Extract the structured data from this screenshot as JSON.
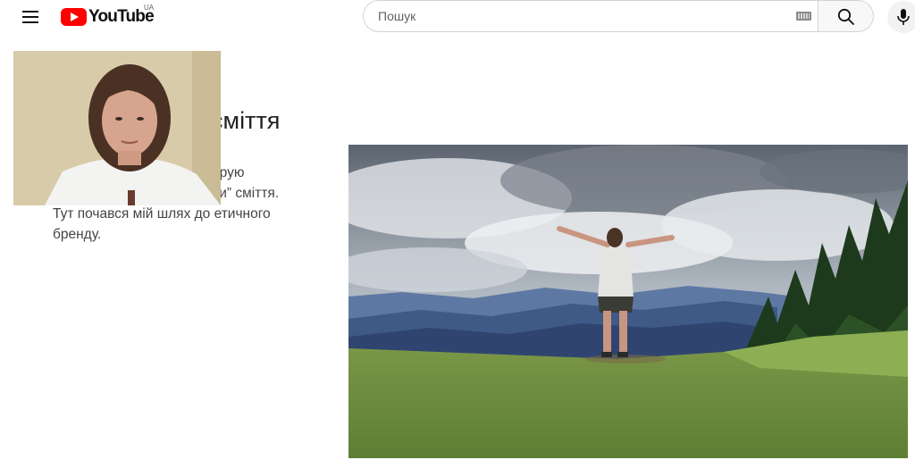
{
  "header": {
    "logo_text": "YouTube",
    "region": "UA",
    "search_placeholder": "Пошук"
  },
  "slide": {
    "title": "сміття",
    "body_lines": [
      "З 2012 року активно мандрую",
      "Україною і бачу гори і “гори” сміття.",
      "Тут почався мій шлях до етичного",
      "бренду."
    ]
  },
  "icons": {
    "menu": "hamburger-menu-icon",
    "search": "search-icon",
    "keyboard": "keyboard-icon",
    "mic": "microphone-icon"
  },
  "colors": {
    "brand": "#ff0000",
    "text": "#0f0f0f",
    "secondary_text": "#606060"
  }
}
